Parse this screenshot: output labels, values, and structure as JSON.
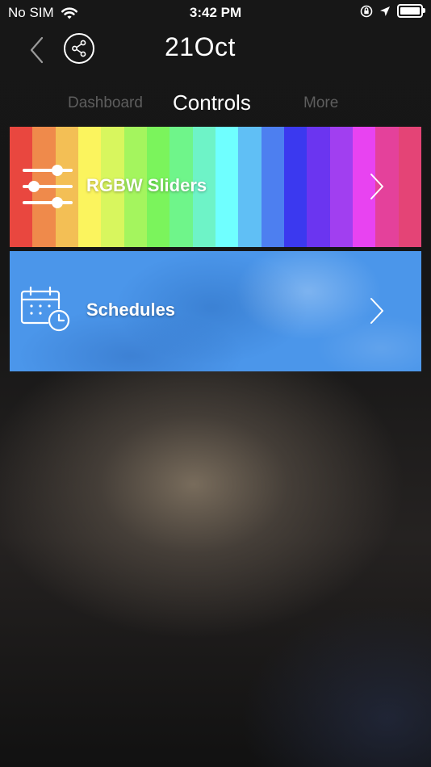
{
  "status_bar": {
    "carrier": "No SIM",
    "time": "3:42 PM",
    "battery_level": 1.0
  },
  "header": {
    "title": "21Oct",
    "back_icon": "chevron-left-icon",
    "share_icon": "share-icon"
  },
  "tabs": [
    {
      "label": "Dashboard",
      "active": false
    },
    {
      "label": "Controls",
      "active": true
    },
    {
      "label": "More",
      "active": false
    }
  ],
  "cards": [
    {
      "label": "RGBW Sliders",
      "icon": "sliders-icon",
      "stripe_colors": [
        "#e9473f",
        "#ef8a4b",
        "#f3bf55",
        "#fbf45e",
        "#d8f65e",
        "#a4f55e",
        "#7bf45c",
        "#6ff58a",
        "#6ef3c7",
        "#6fffff",
        "#60bff5",
        "#4d7ff0",
        "#3b39ef",
        "#6b35f0",
        "#a13ff0",
        "#e843f1",
        "#e4419b",
        "#e44476"
      ]
    },
    {
      "label": "Schedules",
      "icon": "calendar-clock-icon",
      "accent": "#4b96ea"
    }
  ]
}
